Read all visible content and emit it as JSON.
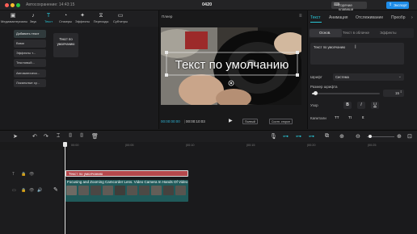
{
  "titlebar": {
    "autosave": "Автосохранение: 14:43:15",
    "project_title": "0420",
    "hotkeys_label": "Горячие клавиши",
    "export_label": "Экспорт",
    "traffic_colors": [
      "#fe5f57",
      "#febc2e",
      "#28c840"
    ]
  },
  "toolbar": {
    "items": [
      {
        "label": "Медиаматериалы",
        "icon": "media-icon"
      },
      {
        "label": "Звук",
        "icon": "audio-icon"
      },
      {
        "label": "Текст",
        "icon": "text-icon"
      },
      {
        "label": "Стикеры",
        "icon": "sticker-icon"
      },
      {
        "label": "Эффекты",
        "icon": "effects-icon"
      },
      {
        "label": "Переходы",
        "icon": "transitions-icon"
      },
      {
        "label": "Субтитры",
        "icon": "subtitles-icon"
      }
    ],
    "active_index": 2,
    "accent": "#29c6d6"
  },
  "sidebar": {
    "items": [
      "Добавить текст",
      "Вами",
      "Эффекты т...",
      "Текстовый...",
      "Автоматическ...",
      "Локальные су..."
    ],
    "selected_index": 0
  },
  "text_card": {
    "label": "Текст по умолчанию"
  },
  "player": {
    "label": "Плеер",
    "overlay_text": "Текст по умолчанию",
    "current_time": "00:00:00:00",
    "total_time": "00:00:10:03",
    "btn_full": "Полный",
    "btn_ratio": "Соотн. сторон"
  },
  "inspector": {
    "tabs": [
      "Текст",
      "Анимация",
      "Отслеживание",
      "Преобр"
    ],
    "active_tab": 0,
    "subtabs": [
      "Основ.",
      "Текст в облачке",
      "Эффекты"
    ],
    "active_subtab": 0,
    "text_value": "Текст по умолчанию",
    "font_label": "Шрифт",
    "font_value": "Система",
    "size_label": "Размер шрифта",
    "size_value": "15",
    "size_level": 0.05,
    "pattern_label": "Узор",
    "format_buttons": [
      "B",
      "I",
      "U"
    ],
    "caps_label": "Капитали",
    "caps_buttons": [
      "TT",
      "Tt",
      "tt"
    ]
  },
  "timeline": {
    "ruler_ticks": [
      "00:00",
      "|00:05",
      "|00:10",
      "|00:15",
      "|00:20",
      "|00:25"
    ],
    "text_clip": "Текст по умолчанию",
    "video_clip": "Focusing and Zooming Camcorder Lens. Video Camera In Hands Of Video"
  }
}
